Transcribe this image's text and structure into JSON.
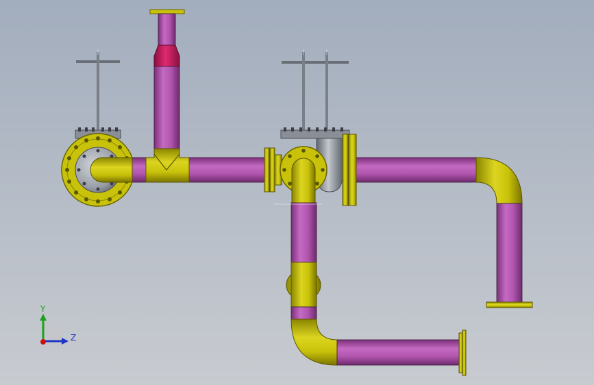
{
  "viewport": {
    "background_top": "#a2adbd",
    "background_bottom": "#c8cbd0"
  },
  "colors": {
    "pipe": "#b256b0",
    "pipe_dark": "#7c2f7a",
    "fitting": "#c9c20a",
    "fitting_dark": "#8b8600",
    "reducer": "#c01a5a",
    "valve_body": "#9a9ea6",
    "valve_dark": "#5f636b",
    "axis_y": "#1aa31a",
    "axis_z": "#1f35c4",
    "axis_x": "#cc1111"
  },
  "triad": {
    "y_label": "Y",
    "z_label": "Z"
  }
}
